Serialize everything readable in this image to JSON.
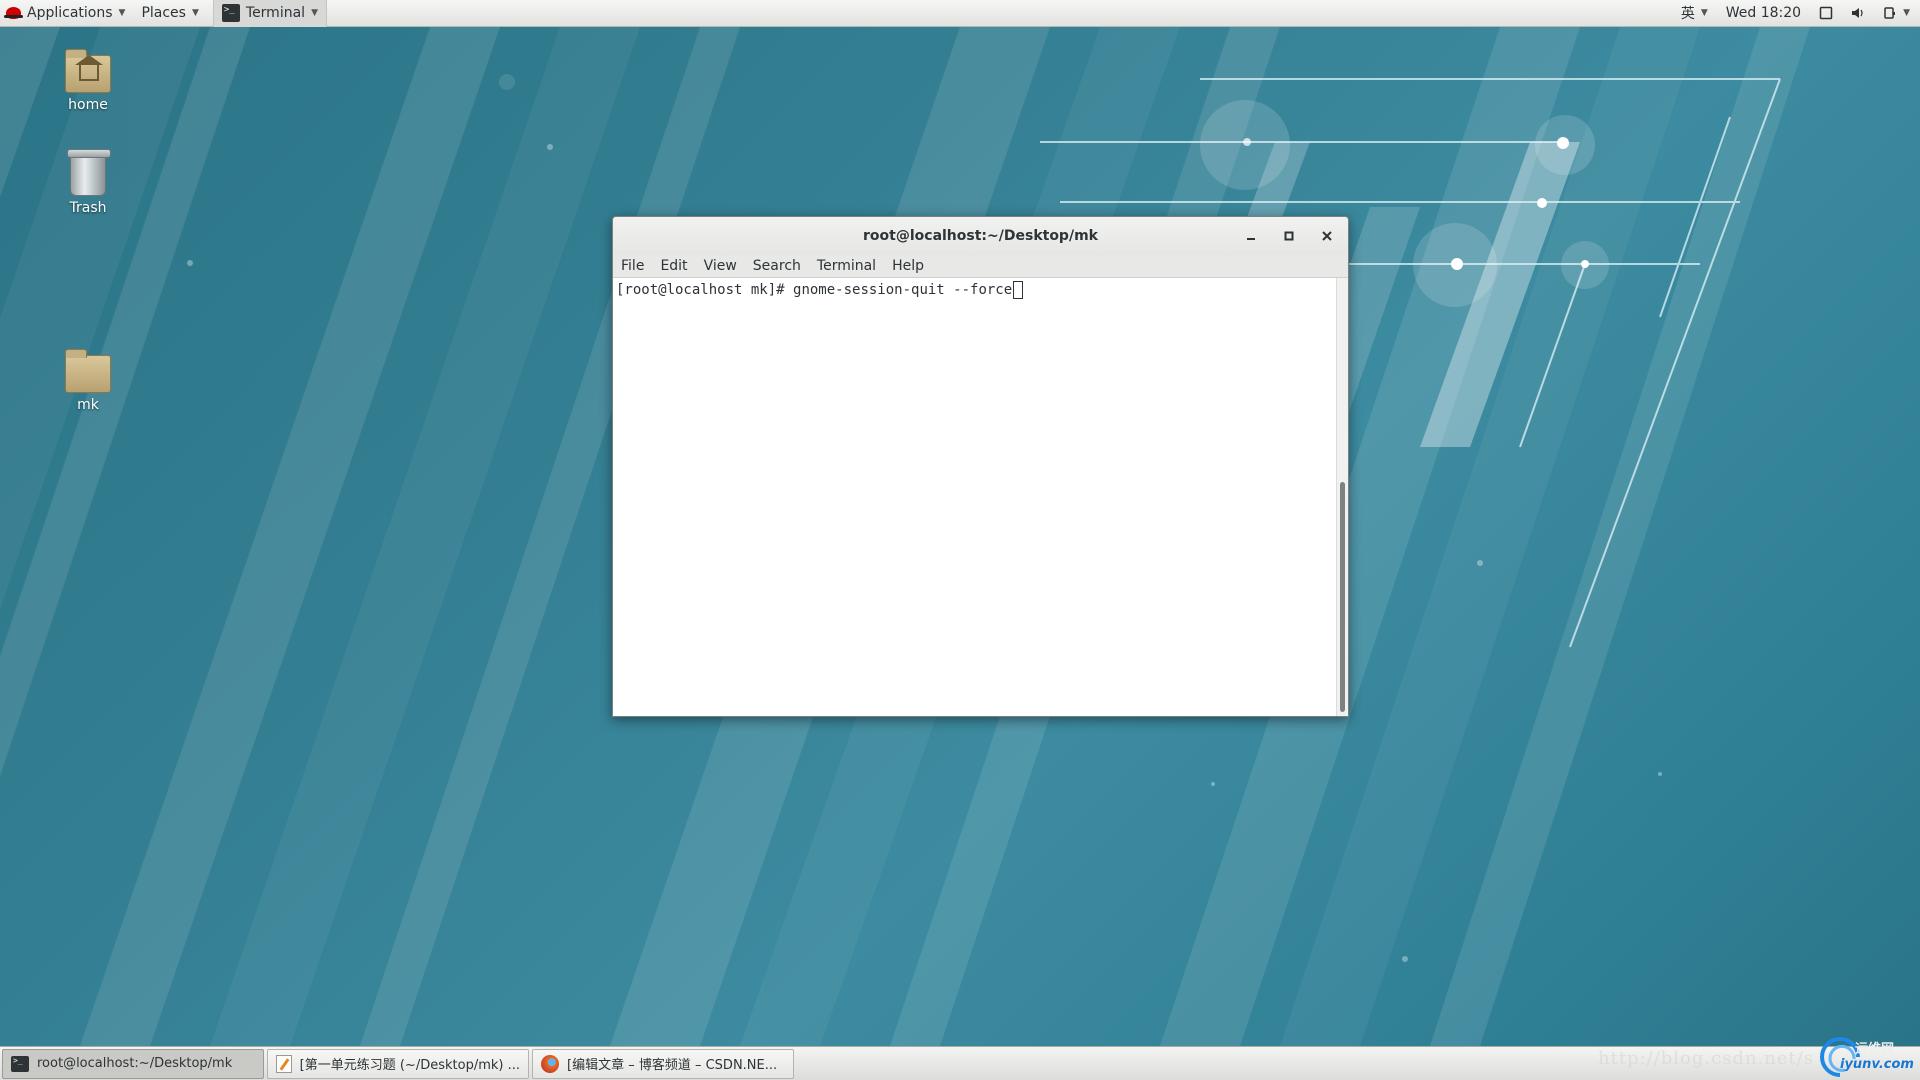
{
  "top_bar": {
    "applications": "Applications",
    "places": "Places",
    "terminal": "Terminal",
    "input_method": "英",
    "clock": "Wed 18:20"
  },
  "desktop": {
    "icons": [
      {
        "label": "home",
        "icon": "home-folder-icon"
      },
      {
        "label": "Trash",
        "icon": "trash-icon"
      },
      {
        "label": "mk",
        "icon": "folder-icon"
      }
    ]
  },
  "terminal_window": {
    "title": "root@localhost:~/Desktop/mk",
    "menu": [
      "File",
      "Edit",
      "View",
      "Search",
      "Terminal",
      "Help"
    ],
    "prompt": "[root@localhost mk]# ",
    "command": "gnome-session-quit --force"
  },
  "taskbar": {
    "items": [
      {
        "label": "root@localhost:~/Desktop/mk",
        "icon": "terminal-icon",
        "active": true
      },
      {
        "label": "[第一单元练习题 (~/Desktop/mk) ...",
        "icon": "text-editor-icon",
        "active": false
      },
      {
        "label": "[编辑文章 – 博客频道 – CSDN.NE...",
        "icon": "firefox-icon",
        "active": false
      }
    ]
  },
  "watermark": {
    "url": "http://blog.csdn.net/s",
    "logo_top": "运维网",
    "logo_bottom": "iyunv.com"
  },
  "colors": {
    "desktop_bg": "#347f93",
    "panel_bg": "#e9e9e7",
    "terminal_bg": "#ffffff"
  }
}
